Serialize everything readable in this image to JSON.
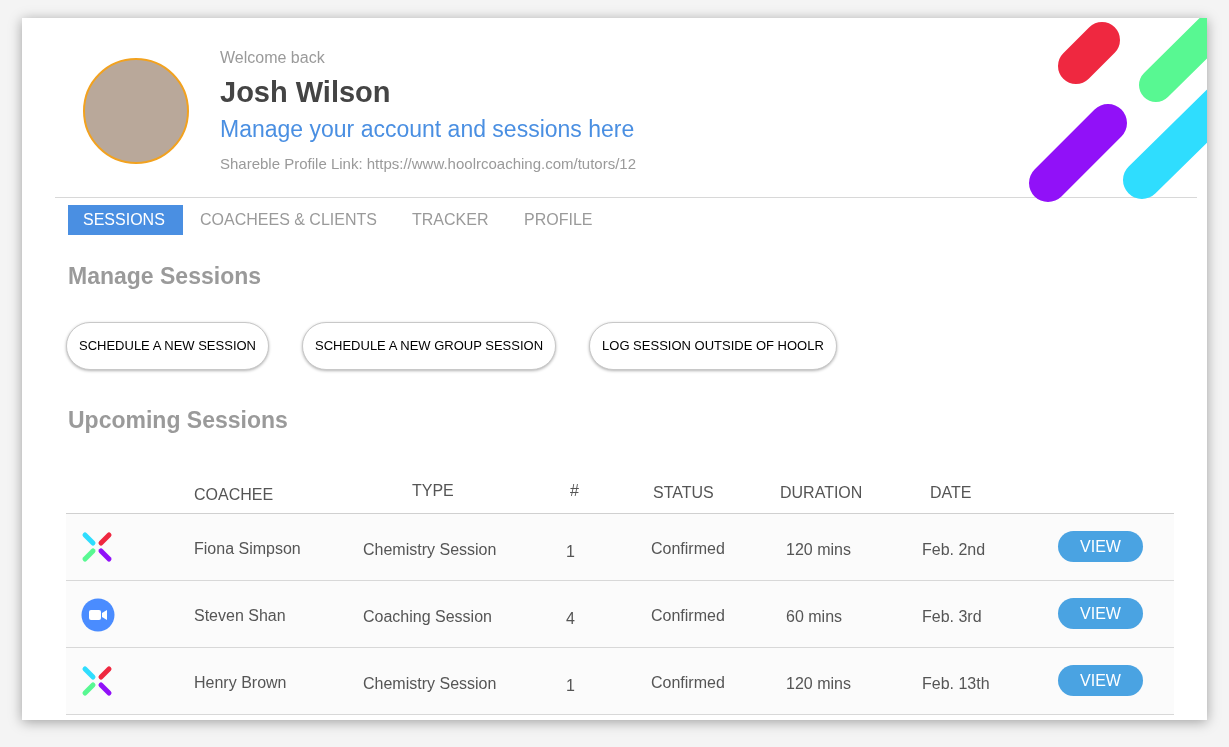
{
  "header": {
    "greeting": "Welcome back",
    "name": "Josh Wilson",
    "subtitle": "Manage your account and sessions here",
    "profile_link": "Shareble Profile Link: https://www.hoolrcoaching.com/tutors/12"
  },
  "tabs": [
    {
      "label": "SESSIONS",
      "selected": true
    },
    {
      "label": "COACHEES & CLIENTS",
      "selected": false
    },
    {
      "label": "TRACKER",
      "selected": false
    },
    {
      "label": "PROFILE",
      "selected": false
    }
  ],
  "manage": {
    "title": "Manage Sessions",
    "buttons": [
      "SCHEDULE A NEW SESSION",
      "SCHEDULE A NEW GROUP SESSION",
      "LOG SESSION OUTSIDE OF HOOLR"
    ]
  },
  "upcoming": {
    "title": "Upcoming Sessions",
    "columns": [
      "COACHEE",
      "TYPE",
      "#",
      "STATUS",
      "DURATION",
      "DATE"
    ],
    "rows": [
      {
        "kind": "hoolr",
        "coachee": "Fiona Simpson",
        "type": "Chemistry Session",
        "count": "1",
        "status": "Confirmed",
        "duration": "120 mins",
        "date": "Feb. 2nd",
        "action": "VIEW"
      },
      {
        "kind": "video",
        "coachee": "Steven Shan",
        "type": "Coaching Session",
        "count": "4",
        "status": "Confirmed",
        "duration": "60 mins",
        "date": "Feb. 3rd",
        "action": "VIEW"
      },
      {
        "kind": "hoolr",
        "coachee": "Henry Brown",
        "type": "Chemistry Session",
        "count": "1",
        "status": "Confirmed",
        "duration": "120 mins",
        "date": "Feb. 13th",
        "action": "VIEW"
      }
    ]
  }
}
